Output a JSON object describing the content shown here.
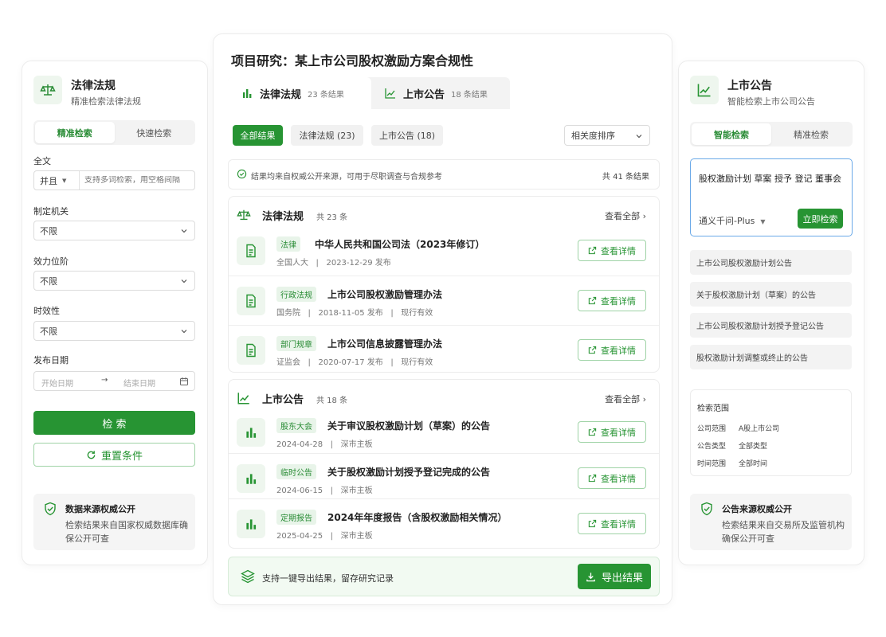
{
  "colors": {
    "primary": "#279433",
    "light_green_bg": "#eef6ee",
    "query_border": "#6aa9e8"
  },
  "left": {
    "title": "法律法规",
    "subtitle": "精准检索法律法规",
    "icon": "scale-icon",
    "tabs": [
      "精准检索",
      "快速检索"
    ],
    "fields": {
      "fulltext_label": "全文",
      "fulltext_operator": "并且",
      "fulltext_placeholder": "支持多词检索，用空格间隔",
      "authority_label": "制定机关",
      "authority_value": "不限",
      "level_label": "效力位阶",
      "level_value": "不限",
      "validity_label": "时效性",
      "validity_value": "不限",
      "date_label": "发布日期",
      "date_start_placeholder": "开始日期",
      "date_arrow": "→",
      "date_end_placeholder": "结束日期"
    },
    "search_button": "检  索",
    "reset_button": "重置条件",
    "note_title": "数据来源权威公开",
    "note_body": "检索结果来自国家权威数据库确保公开可查"
  },
  "center": {
    "title": "项目研究：某上市公司股权激励方案合规性",
    "tabs": [
      {
        "label": "法律法规",
        "count": "23 条结果"
      },
      {
        "label": "上市公告",
        "count": "18 条结果"
      }
    ],
    "chips": [
      "全部结果",
      "法律法规 (23)",
      "上市公告 (18)"
    ],
    "sort": "相关度排序",
    "info_text": "结果均来自权威公开来源，可用于尽职调查与合规参考",
    "info_total": "共 41 条结果",
    "view_all": "查看全部",
    "detail_label": "查看详情",
    "meta_sep": "|",
    "laws": {
      "title": "法律法规",
      "count": "共 23 条",
      "items": [
        {
          "tag": "法律",
          "title": "中华人民共和国公司法（2023年修订）",
          "source": "全国人大",
          "date": "2023-12-29 发布",
          "status": ""
        },
        {
          "tag": "行政法规",
          "title": "上市公司股权激励管理办法",
          "source": "国务院",
          "date": "2018-11-05 发布",
          "status": "现行有效"
        },
        {
          "tag": "部门规章",
          "title": "上市公司信息披露管理办法",
          "source": "证监会",
          "date": "2020-07-17 发布",
          "status": "现行有效"
        }
      ]
    },
    "announcements": {
      "title": "上市公告",
      "count": "共 18 条",
      "items": [
        {
          "tag": "股东大会",
          "title": "关于审议股权激励计划（草案）的公告",
          "date": "2024-04-28",
          "board": "深市主板"
        },
        {
          "tag": "临时公告",
          "title": "关于股权激励计划授予登记完成的公告",
          "date": "2024-06-15",
          "board": "深市主板"
        },
        {
          "tag": "定期报告",
          "title": "2024年年度报告（含股权激励相关情况）",
          "date": "2025-04-25",
          "board": "深市主板"
        }
      ]
    },
    "export_text": "支持一键导出结果，留存研究记录",
    "export_button": "导出结果"
  },
  "right": {
    "title": "上市公告",
    "subtitle": "智能检索上市公司公告",
    "icon": "trend-chart-icon",
    "tabs": [
      "智能检索",
      "精准检索"
    ],
    "query": "股权激励计划 草案 授予 登记 董事会",
    "model": "通义千问-Plus",
    "search_button": "立即检索",
    "suggestions": [
      "上市公司股权激励计划公告",
      "关于股权激励计划（草案）的公告",
      "上市公司股权激励计划授予登记公告",
      "股权激励计划调整或终止的公告"
    ],
    "scope_title": "检索范围",
    "scope": [
      {
        "key": "公司范围",
        "value": "A股上市公司"
      },
      {
        "key": "公告类型",
        "value": "全部类型"
      },
      {
        "key": "时间范围",
        "value": "全部时间"
      }
    ],
    "note_title": "公告来源权威公开",
    "note_body": "检索结果来自交易所及监管机构确保公开可查"
  }
}
